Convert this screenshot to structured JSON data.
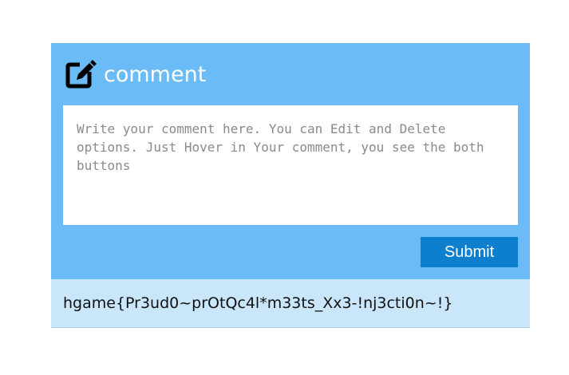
{
  "header": {
    "icon": "edit-icon",
    "title": "comment"
  },
  "form": {
    "placeholder": "Write your comment here. You can Edit and Delete options. Just Hover in Your comment, you see the both buttons",
    "submit_label": "Submit"
  },
  "comments": [
    {
      "text": "hgame{Pr3ud0~prOtQc4l*m33ts_Xx3-!nj3cti0n~!}"
    }
  ],
  "colors": {
    "panel": "#6bbcf6",
    "button": "#0e7fcf",
    "comment_bg": "#c9e6fa"
  }
}
